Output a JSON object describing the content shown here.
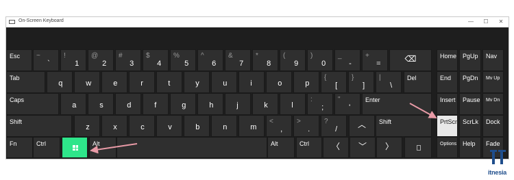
{
  "window": {
    "title": "On-Screen Keyboard",
    "minimize_glyph": "—",
    "maximize_glyph": "☐",
    "close_glyph": "✕"
  },
  "rows": {
    "row1": [
      {
        "name": "key-esc",
        "main": "Esc"
      },
      {
        "name": "key-tilde",
        "top": "~",
        "bot": "`"
      },
      {
        "name": "key-1",
        "top": "!",
        "bot": "1"
      },
      {
        "name": "key-2",
        "top": "@",
        "bot": "2"
      },
      {
        "name": "key-3",
        "top": "#",
        "bot": "3"
      },
      {
        "name": "key-4",
        "top": "$",
        "bot": "4"
      },
      {
        "name": "key-5",
        "top": "%",
        "bot": "5"
      },
      {
        "name": "key-6",
        "top": "^",
        "bot": "6"
      },
      {
        "name": "key-7",
        "top": "&",
        "bot": "7"
      },
      {
        "name": "key-8",
        "top": "*",
        "bot": "8"
      },
      {
        "name": "key-9",
        "top": "(",
        "bot": "9"
      },
      {
        "name": "key-0",
        "top": ")",
        "bot": "0"
      },
      {
        "name": "key-minus",
        "top": "_",
        "bot": "-"
      },
      {
        "name": "key-equals",
        "top": "+",
        "bot": "="
      },
      {
        "name": "key-backspace",
        "main": "⌫"
      },
      {
        "name": "key-home",
        "main": "Home"
      },
      {
        "name": "key-pgup",
        "main": "PgUp"
      },
      {
        "name": "key-nav",
        "main": "Nav"
      }
    ],
    "row2": [
      {
        "name": "key-tab",
        "main": "Tab"
      },
      {
        "name": "key-q",
        "main": "q"
      },
      {
        "name": "key-w",
        "main": "w"
      },
      {
        "name": "key-e",
        "main": "e"
      },
      {
        "name": "key-r",
        "main": "r"
      },
      {
        "name": "key-t",
        "main": "t"
      },
      {
        "name": "key-y",
        "main": "y"
      },
      {
        "name": "key-u",
        "main": "u"
      },
      {
        "name": "key-i",
        "main": "i"
      },
      {
        "name": "key-o",
        "main": "o"
      },
      {
        "name": "key-p",
        "main": "p"
      },
      {
        "name": "key-lbracket",
        "top": "{",
        "bot": "["
      },
      {
        "name": "key-rbracket",
        "top": "}",
        "bot": "]"
      },
      {
        "name": "key-backslash",
        "top": "|",
        "bot": "\\"
      },
      {
        "name": "key-del",
        "main": "Del"
      },
      {
        "name": "key-end",
        "main": "End"
      },
      {
        "name": "key-pgdn",
        "main": "PgDn"
      },
      {
        "name": "key-mvup",
        "main": "Mv Up"
      }
    ],
    "row3": [
      {
        "name": "key-caps",
        "main": "Caps"
      },
      {
        "name": "key-a",
        "main": "a"
      },
      {
        "name": "key-s",
        "main": "s"
      },
      {
        "name": "key-d",
        "main": "d"
      },
      {
        "name": "key-f",
        "main": "f"
      },
      {
        "name": "key-g",
        "main": "g"
      },
      {
        "name": "key-h",
        "main": "h"
      },
      {
        "name": "key-j",
        "main": "j"
      },
      {
        "name": "key-k",
        "main": "k"
      },
      {
        "name": "key-l",
        "main": "l"
      },
      {
        "name": "key-semicolon",
        "top": ":",
        "bot": ";"
      },
      {
        "name": "key-quote",
        "top": "\"",
        "bot": "'"
      },
      {
        "name": "key-enter",
        "main": "Enter"
      },
      {
        "name": "key-insert",
        "main": "Insert"
      },
      {
        "name": "key-pause",
        "main": "Pause"
      },
      {
        "name": "key-mvdn",
        "main": "Mv Dn"
      }
    ],
    "row4": [
      {
        "name": "key-lshift",
        "main": "Shift"
      },
      {
        "name": "key-z",
        "main": "z"
      },
      {
        "name": "key-x",
        "main": "x"
      },
      {
        "name": "key-c",
        "main": "c"
      },
      {
        "name": "key-v",
        "main": "v"
      },
      {
        "name": "key-b",
        "main": "b"
      },
      {
        "name": "key-n",
        "main": "n"
      },
      {
        "name": "key-m",
        "main": "m"
      },
      {
        "name": "key-comma",
        "top": "<",
        "bot": ","
      },
      {
        "name": "key-period",
        "top": ">",
        "bot": "."
      },
      {
        "name": "key-slash",
        "top": "?",
        "bot": "/"
      },
      {
        "name": "key-up",
        "main": "︿"
      },
      {
        "name": "key-rshift",
        "main": "Shift"
      },
      {
        "name": "key-prtscn",
        "main": "PrtScn"
      },
      {
        "name": "key-scrlk",
        "main": "ScrLk"
      },
      {
        "name": "key-dock",
        "main": "Dock"
      }
    ],
    "row5": [
      {
        "name": "key-fn",
        "main": "Fn"
      },
      {
        "name": "key-lctrl",
        "main": "Ctrl"
      },
      {
        "name": "key-windows",
        "main": ""
      },
      {
        "name": "key-lalt",
        "main": "Alt"
      },
      {
        "name": "key-space",
        "main": ""
      },
      {
        "name": "key-ralt",
        "main": "Alt"
      },
      {
        "name": "key-rctrl",
        "main": "Ctrl"
      },
      {
        "name": "key-left",
        "main": "〈"
      },
      {
        "name": "key-down",
        "main": "﹀"
      },
      {
        "name": "key-right",
        "main": "〉"
      },
      {
        "name": "key-menu",
        "main": ""
      },
      {
        "name": "key-options",
        "main": "Options"
      },
      {
        "name": "key-help",
        "main": "Help"
      },
      {
        "name": "key-fade",
        "main": "Fade"
      }
    ]
  },
  "accent": {
    "windows_key": "#2ee58a",
    "arrow": "#e89aa6",
    "highlight": "#e8e8e8"
  },
  "watermark": {
    "text": "itnesia"
  }
}
